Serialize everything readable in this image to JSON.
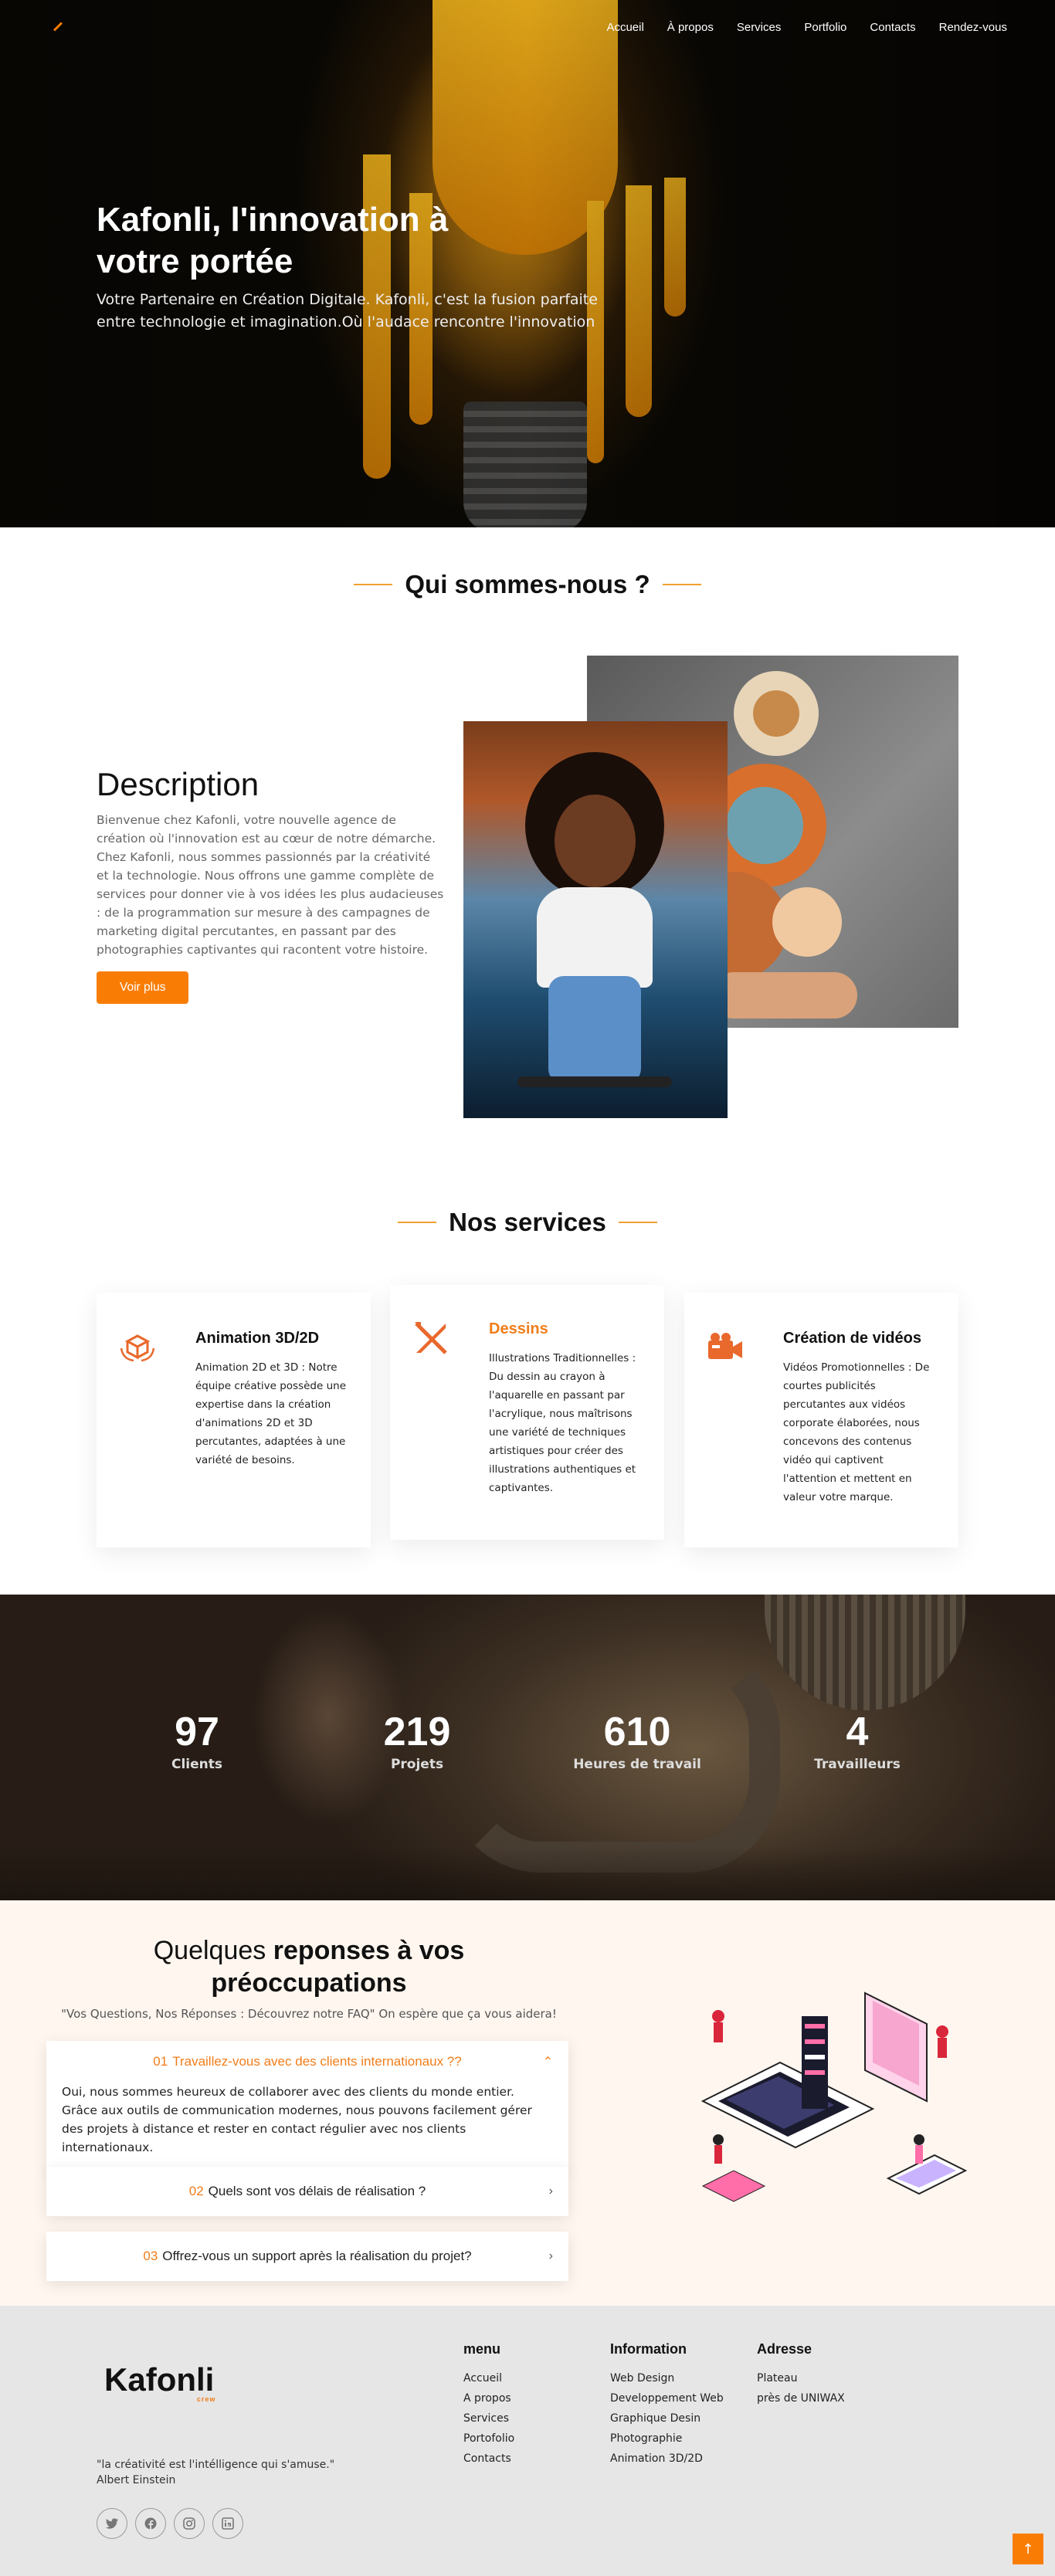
{
  "nav": {
    "items": [
      "Accueil",
      "À propos",
      "Services",
      "Portfolio",
      "Contacts",
      "Rendez-vous"
    ]
  },
  "hero": {
    "title": "Kafonli, l'innovation à votre portée",
    "subtitle": "Votre Partenaire en Création Digitale. Kafonli, c'est la fusion parfaite entre technologie et imagination.Où l'audace rencontre l'innovation"
  },
  "about": {
    "section_title": "Qui sommes-nous ?",
    "heading": "Description",
    "text": "Bienvenue chez Kafonli, votre nouvelle agence de création où l'innovation est au cœur de notre démarche. Chez Kafonli, nous sommes passionnés par la créativité et la technologie. Nous offrons une gamme complète de services pour donner vie à vos idées les plus audacieuses : de la programmation sur mesure à des campagnes de marketing digital percutantes, en passant par des photographies captivantes qui racontent votre histoire.",
    "button": "Voir plus"
  },
  "services": {
    "section_title": "Nos services",
    "cards": [
      {
        "icon": "3d-cube-icon",
        "title": "Animation 3D/2D",
        "text": "Animation 2D et 3D : Notre équipe créative possède une expertise dans la création d'animations 2D et 3D percutantes, adaptées à une variété de besoins."
      },
      {
        "icon": "pencil-brush-icon",
        "title": "Dessins",
        "text": "Illustrations Traditionnelles : Du dessin au crayon à l'aquarelle en passant par l'acrylique, nous maîtrisons une variété de techniques artistiques pour créer des illustrations authentiques et captivantes."
      },
      {
        "icon": "video-camera-icon",
        "title": "Création de vidéos",
        "text": "Vidéos Promotionnelles : De courtes publicités percutantes aux vidéos corporate élaborées, nous concevons des contenus vidéo qui captivent l'attention et mettent en valeur votre marque."
      }
    ]
  },
  "stats": [
    {
      "value": "97",
      "label": "Clients"
    },
    {
      "value": "219",
      "label": "Projets"
    },
    {
      "value": "610",
      "label": "Heures de travail"
    },
    {
      "value": "4",
      "label": "Travailleurs"
    }
  ],
  "faq": {
    "title_light": "Quelques",
    "title_bold": "reponses à vos préoccupations",
    "subtitle": "\"Vos Questions, Nos Réponses : Découvrez notre FAQ\" On espère que ça vous aidera!",
    "items": [
      {
        "num": "01",
        "question": "Travaillez-vous avec des clients internationaux ??",
        "answer": "Oui, nous sommes heureux de collaborer avec des clients du monde entier. Grâce aux outils de communication modernes, nous pouvons facilement gérer des projets à distance et rester en contact régulier avec nos clients internationaux."
      },
      {
        "num": "02",
        "question": "Quels sont vos délais de réalisation ?"
      },
      {
        "num": "03",
        "question": "Offrez-vous un support après la réalisation du projet?"
      }
    ]
  },
  "footer": {
    "logo": "afonli",
    "logo_k": "K",
    "logo_tag": "crew",
    "quote": "\"la créativité est l'intélligence qui s'amuse.\"",
    "quote_author": "Albert Einstein",
    "menu": {
      "title": "menu",
      "items": [
        "Accueil",
        "A propos",
        "Services",
        "Portofolio",
        "Contacts"
      ]
    },
    "info": {
      "title": "Information",
      "items": [
        "Web Design",
        "Developpement Web",
        "Graphique Desin",
        "Photographie",
        "Animation 3D/2D"
      ]
    },
    "address": {
      "title": "Adresse",
      "items": [
        "Plateau",
        "près de UNIWAX"
      ]
    },
    "social_icons": [
      "twitter-icon",
      "facebook-icon",
      "instagram-icon",
      "linkedin-icon"
    ]
  },
  "colors": {
    "accent": "#f97d05",
    "faq_bg": "#fff6ef",
    "footer_bg": "#e6e6e6"
  }
}
